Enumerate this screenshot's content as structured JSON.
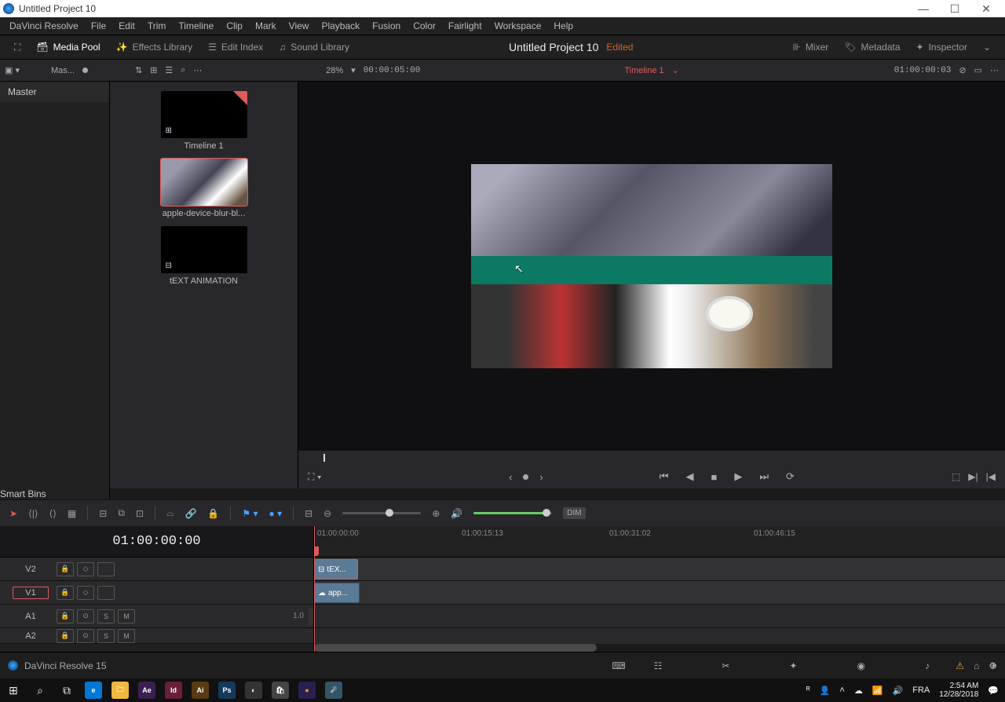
{
  "window": {
    "title": "Untitled Project 10"
  },
  "menu": [
    "DaVinci Resolve",
    "File",
    "Edit",
    "Trim",
    "Timeline",
    "Clip",
    "Mark",
    "View",
    "Playback",
    "Fusion",
    "Color",
    "Fairlight",
    "Workspace",
    "Help"
  ],
  "toolbar": {
    "media_pool": "Media Pool",
    "effects": "Effects Library",
    "edit_index": "Edit Index",
    "sound": "Sound Library",
    "project": "Untitled Project 10",
    "status": "Edited",
    "mixer": "Mixer",
    "metadata": "Metadata",
    "inspector": "Inspector"
  },
  "subbar": {
    "bin": "Mas...",
    "zoom": "28%",
    "dur": "00:00:05:00",
    "timeline": "Timeline 1",
    "tc": "01:00:00:03"
  },
  "bins": {
    "master": "Master",
    "smart": "Smart Bins"
  },
  "media": [
    {
      "label": "Timeline 1",
      "type": "timeline"
    },
    {
      "label": "apple-device-blur-bl...",
      "type": "clip",
      "selected": true
    },
    {
      "label": "tEXT ANIMATION",
      "type": "comp"
    }
  ],
  "transport": {
    "timecode": "01:00:00:00"
  },
  "ruler": [
    "01:00:00:00",
    "01:00:15:13",
    "01:00:31:02",
    "01:00:46:15"
  ],
  "tracks": {
    "video": [
      {
        "name": "V2",
        "clip": "tEX..."
      },
      {
        "name": "V1",
        "clip": "app...",
        "selected": true
      }
    ],
    "audio": [
      {
        "name": "A1",
        "db": "1.0",
        "sm": true
      },
      {
        "name": "A2",
        "sm": true
      }
    ]
  },
  "tooltray": {
    "dim": "DIM"
  },
  "statusbar": {
    "app": "DaVinci Resolve 15"
  },
  "taskbar": {
    "lang": "FRA",
    "time": "2:54 AM",
    "date": "12/28/2018",
    "apps": [
      {
        "bg": "#0a0a0a",
        "label": "⊞"
      },
      {
        "bg": "#0a0a0a",
        "label": "⊙"
      },
      {
        "bg": "#0a0a0a",
        "label": "⧉"
      },
      {
        "bg": "#0078d7",
        "label": "e"
      },
      {
        "bg": "#f0b840",
        "label": "🗀"
      },
      {
        "bg": "#3a2052",
        "label": "Ae"
      },
      {
        "bg": "#6b1e3c",
        "label": "Id"
      },
      {
        "bg": "#5a3a14",
        "label": "Ai"
      },
      {
        "bg": "#143a5a",
        "label": "Ps"
      },
      {
        "bg": "#3a3a3a",
        "label": "◐"
      },
      {
        "bg": "#444",
        "label": "🛍"
      },
      {
        "bg": "#ff9500",
        "label": "●"
      },
      {
        "bg": "#356",
        "label": "☄"
      }
    ]
  }
}
